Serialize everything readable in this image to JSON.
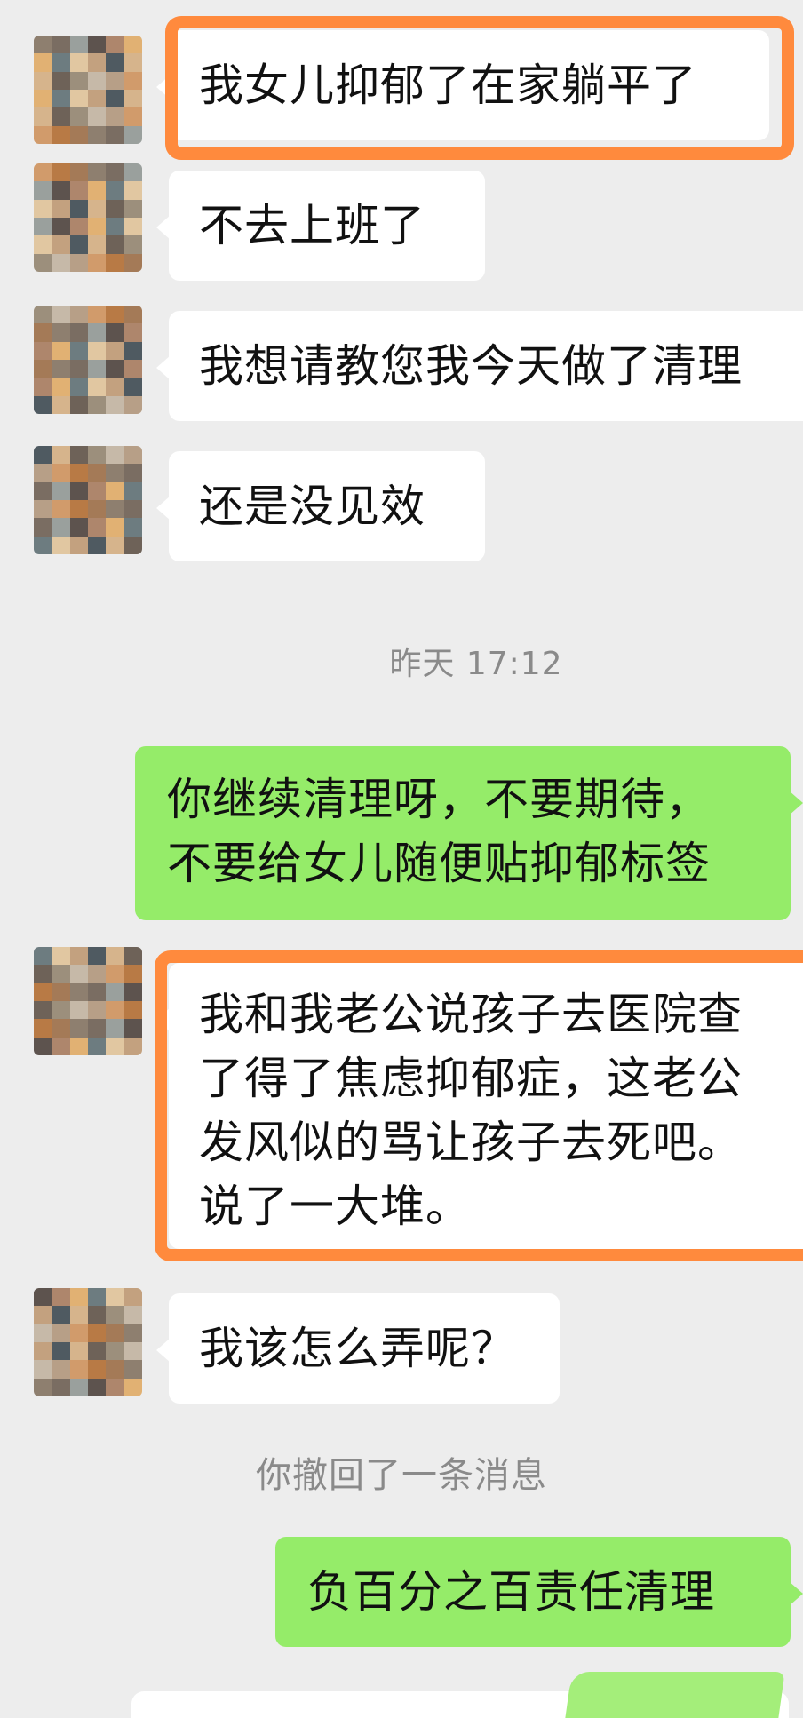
{
  "chat": {
    "messages": [
      {
        "id": "m1",
        "direction": "in",
        "text": "我女儿抑郁了在家躺平了",
        "highlighted": true
      },
      {
        "id": "m2",
        "direction": "in",
        "text": "不去上班了",
        "highlighted": false
      },
      {
        "id": "m3",
        "direction": "in",
        "text": "我想请教您我今天做了清理",
        "highlighted": false
      },
      {
        "id": "m4",
        "direction": "in",
        "text": "还是没见效",
        "highlighted": false
      },
      {
        "id": "m5",
        "direction": "out",
        "text": "你继续清理呀，不要期待，\n不要给女儿随便贴抑郁标签",
        "highlighted": false
      },
      {
        "id": "m6",
        "direction": "in",
        "text": "我和我老公说孩子去医院查\n了得了焦虑抑郁症，这老公\n发风似的骂让孩子去死吧。\n说了一大堆。",
        "highlighted": true
      },
      {
        "id": "m7",
        "direction": "in",
        "text": "我该怎么弄呢？",
        "highlighted": false
      },
      {
        "id": "m8",
        "direction": "out",
        "text": "负百分之百责任清理",
        "highlighted": false
      }
    ],
    "timestamp": "昨天 17:12",
    "recall_notice": "你撤回了一条消息"
  },
  "colors": {
    "background": "#ededed",
    "incoming_bubble": "#ffffff",
    "outgoing_bubble": "#95ec69",
    "highlight": "#ff8a3d",
    "system_text": "#8a8a8a"
  },
  "icons": {
    "avatar": "pixelated-avatar-icon"
  }
}
